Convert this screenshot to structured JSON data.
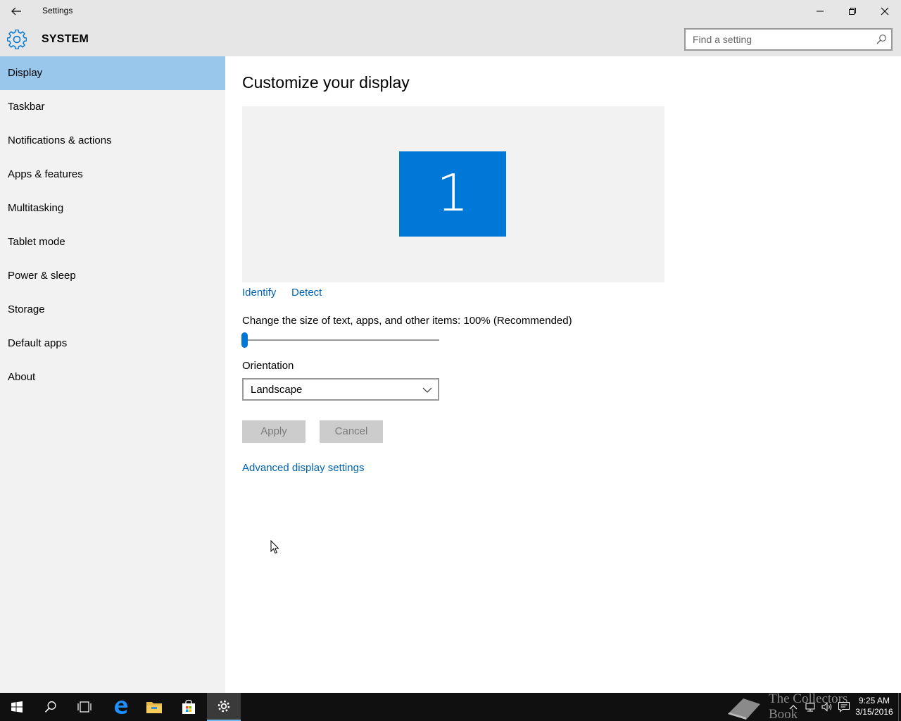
{
  "window": {
    "title": "Settings"
  },
  "header": {
    "section": "SYSTEM",
    "search_placeholder": "Find a setting"
  },
  "sidebar": {
    "items": [
      {
        "label": "Display",
        "active": true
      },
      {
        "label": "Taskbar"
      },
      {
        "label": "Notifications & actions"
      },
      {
        "label": "Apps & features"
      },
      {
        "label": "Multitasking"
      },
      {
        "label": "Tablet mode"
      },
      {
        "label": "Power & sleep"
      },
      {
        "label": "Storage"
      },
      {
        "label": "Default apps"
      },
      {
        "label": "About"
      }
    ]
  },
  "content": {
    "title": "Customize your display",
    "monitor_number": "1",
    "identify_label": "Identify",
    "detect_label": "Detect",
    "scale_label": "Change the size of text, apps, and other items: 100% (Recommended)",
    "scale_slider_fraction": 0,
    "orientation_label": "Orientation",
    "orientation_value": "Landscape",
    "apply_label": "Apply",
    "cancel_label": "Cancel",
    "advanced_link": "Advanced display settings"
  },
  "taskbar": {
    "items": [
      "start-icon",
      "search-icon",
      "task-view-icon",
      "edge-icon",
      "file-explorer-icon",
      "store-icon",
      "settings-icon"
    ],
    "watermark": "The Collectors Book",
    "time": "9:25 AM",
    "date": "3/15/2016"
  },
  "colors": {
    "accent": "#0078d7",
    "sidebar_active": "#99c7ec",
    "link": "#0063b1",
    "chrome": "#e6e6e6",
    "sidebar_bg": "#f2f2f2",
    "taskbar_bg": "#101010"
  }
}
